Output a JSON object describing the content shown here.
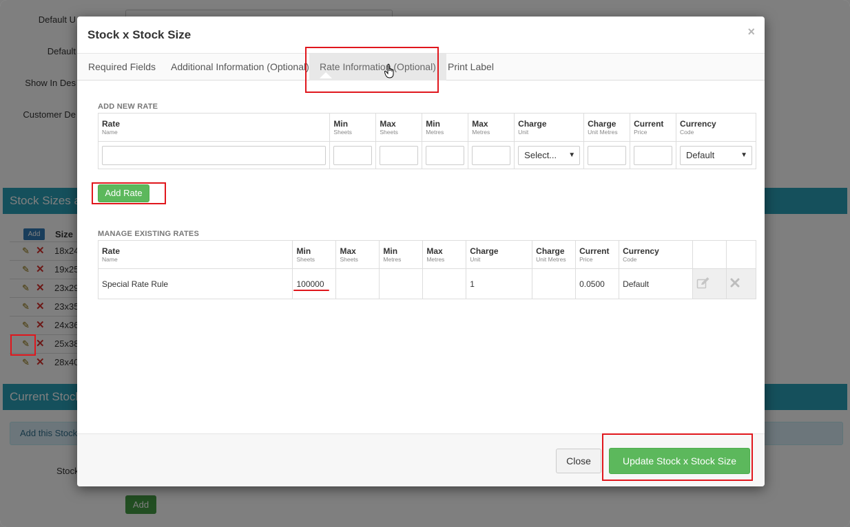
{
  "background": {
    "labels": [
      "Default U",
      "Default",
      "Show In Des",
      "Customer De",
      "Stock"
    ],
    "panel_stock_sizes": "Stock Sizes a",
    "panel_current_stock": "Current Stock",
    "add_small": "Add",
    "size_header": "Size",
    "sizes": [
      "18x24",
      "19x25",
      "23x29",
      "23x35",
      "24x36",
      "25x38",
      "28x40"
    ],
    "info_text": "Add this Stock",
    "add_button": "Add"
  },
  "modal": {
    "title": "Stock x Stock Size",
    "close_glyph": "×",
    "tabs": [
      {
        "label": "Required Fields"
      },
      {
        "label": "Additional Information (Optional)"
      },
      {
        "label": "Rate Information (Optional)"
      },
      {
        "label": "Print Label"
      }
    ],
    "add_new": {
      "section_label": "ADD NEW RATE",
      "headers": [
        {
          "main": "Rate",
          "sub": "Name"
        },
        {
          "main": "Min",
          "sub": "Sheets"
        },
        {
          "main": "Max",
          "sub": "Sheets"
        },
        {
          "main": "Min",
          "sub": "Metres"
        },
        {
          "main": "Max",
          "sub": "Metres"
        },
        {
          "main": "Charge",
          "sub": "Unit"
        },
        {
          "main": "Charge",
          "sub": "Unit Metres"
        },
        {
          "main": "Current",
          "sub": "Price"
        },
        {
          "main": "Currency",
          "sub": "Code"
        }
      ],
      "charge_unit_select": "Select...",
      "currency_select": "Default",
      "add_rate_button": "Add Rate"
    },
    "manage": {
      "section_label": "MANAGE EXISTING RATES",
      "headers": [
        {
          "main": "Rate",
          "sub": "Name"
        },
        {
          "main": "Min",
          "sub": "Sheets"
        },
        {
          "main": "Max",
          "sub": "Sheets"
        },
        {
          "main": "Min",
          "sub": "Metres"
        },
        {
          "main": "Max",
          "sub": "Metres"
        },
        {
          "main": "Charge",
          "sub": "Unit"
        },
        {
          "main": "Charge",
          "sub": "Unit Metres"
        },
        {
          "main": "Current",
          "sub": "Price"
        },
        {
          "main": "Currency",
          "sub": "Code"
        }
      ],
      "rows": [
        {
          "rate_name": "Special Rate Rule",
          "min_sheets": "100000",
          "max_sheets": "",
          "min_metres": "",
          "max_metres": "",
          "charge_unit": "1",
          "charge_unit_metres": "",
          "current_price": "0.0500",
          "currency_code": "Default"
        }
      ]
    },
    "footer": {
      "close_button": "Close",
      "update_button": "Update Stock x Stock Size"
    }
  },
  "colors": {
    "highlight": "#e0161c",
    "success": "#5cb85c",
    "panel_header": "#2aa0b8"
  }
}
